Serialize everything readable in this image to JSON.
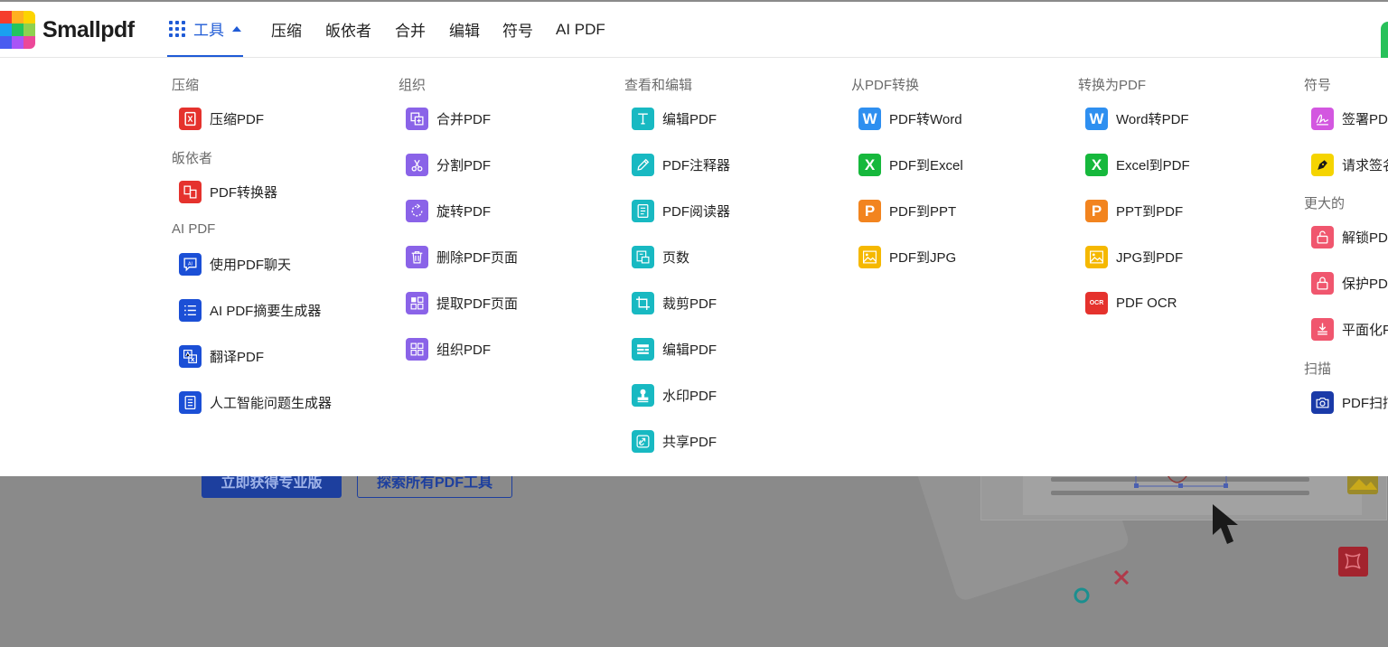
{
  "brand": {
    "name": "Smallpdf"
  },
  "nav": {
    "tools_label": "工具",
    "items": [
      "压缩",
      "皈依者",
      "合并",
      "编辑",
      "符号",
      "AI PDF"
    ]
  },
  "hero": {
    "primary_button": "立即获得专业版",
    "secondary_button": "探索所有PDF工具"
  },
  "menu": {
    "col1": {
      "compress": {
        "title": "压缩",
        "items": [
          {
            "label": "压缩PDF"
          }
        ]
      },
      "convert": {
        "title": "皈依者",
        "items": [
          {
            "label": "PDF转换器"
          }
        ]
      },
      "ai": {
        "title": "AI PDF",
        "items": [
          {
            "label": "使用PDF聊天"
          },
          {
            "label": "AI PDF摘要生成器"
          },
          {
            "label": "翻译PDF"
          },
          {
            "label": "人工智能问题生成器"
          }
        ]
      }
    },
    "col2": {
      "title": "组织",
      "items": [
        {
          "label": "合并PDF"
        },
        {
          "label": "分割PDF"
        },
        {
          "label": "旋转PDF"
        },
        {
          "label": "删除PDF页面"
        },
        {
          "label": "提取PDF页面"
        },
        {
          "label": "组织PDF"
        }
      ]
    },
    "col3": {
      "title": "查看和编辑",
      "items": [
        {
          "label": "编辑PDF"
        },
        {
          "label": "PDF注释器"
        },
        {
          "label": "PDF阅读器"
        },
        {
          "label": "页数"
        },
        {
          "label": "裁剪PDF"
        },
        {
          "label": "编辑PDF"
        },
        {
          "label": "水印PDF"
        },
        {
          "label": "共享PDF"
        }
      ]
    },
    "col4": {
      "title": "从PDF转换",
      "items": [
        {
          "label": "PDF转Word"
        },
        {
          "label": "PDF到Excel"
        },
        {
          "label": "PDF到PPT"
        },
        {
          "label": "PDF到JPG"
        }
      ]
    },
    "col5": {
      "title": "转换为PDF",
      "items": [
        {
          "label": "Word转PDF"
        },
        {
          "label": "Excel到PDF"
        },
        {
          "label": "PPT到PDF"
        },
        {
          "label": "JPG到PDF"
        },
        {
          "label": "PDF OCR"
        }
      ]
    },
    "col6": {
      "sign": {
        "title": "符号",
        "items": [
          {
            "label": "签署PDF"
          },
          {
            "label": "请求签名"
          }
        ]
      },
      "more": {
        "title": "更大的",
        "items": [
          {
            "label": "解锁PDF"
          },
          {
            "label": "保护PDF"
          },
          {
            "label": "平面化PDF"
          }
        ]
      },
      "scan": {
        "title": "扫描",
        "items": [
          {
            "label": "PDF扫描仪"
          }
        ]
      }
    }
  },
  "tile_text": {
    "word": "W",
    "excel": "X",
    "ppt": "P",
    "ocr": "OCR",
    "ai": "AI"
  },
  "colors": {
    "compress": "#e5322d",
    "ai": "#1b4fd6",
    "organize": "#8a63e8",
    "edit": "#18b9c2",
    "word": "#2e8ff0",
    "excel": "#16b83c",
    "ppt": "#f2841f",
    "jpg": "#f5b800",
    "ocr": "#e5322d",
    "sign": "#d357e0",
    "request_sign": "#f5d400",
    "security": "#f0566e",
    "scan": "#1a3aa8",
    "accent": "#1f5bd6"
  }
}
